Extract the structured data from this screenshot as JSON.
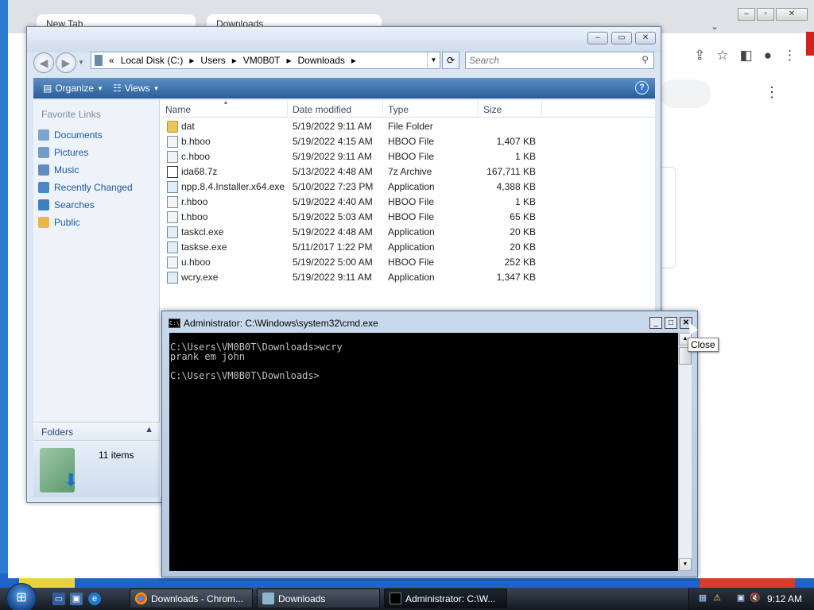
{
  "browser": {
    "tab1_label": "New Tab",
    "tab2_label": "Downloads"
  },
  "explorer": {
    "path": [
      "Local Disk (C:)",
      "Users",
      "VM0B0T",
      "Downloads"
    ],
    "search_placeholder": "Search",
    "toolbar": {
      "organize_label": "Organize",
      "views_label": "Views"
    },
    "favorite_links_header": "Favorite Links",
    "favorite_links": [
      {
        "label": "Documents",
        "icon": "documents-icon"
      },
      {
        "label": "Pictures",
        "icon": "pictures-icon"
      },
      {
        "label": "Music",
        "icon": "music-icon"
      },
      {
        "label": "Recently Changed",
        "icon": "recently-changed-icon"
      },
      {
        "label": "Searches",
        "icon": "searches-icon"
      },
      {
        "label": "Public",
        "icon": "public-folder-icon"
      }
    ],
    "folders_label": "Folders",
    "item_count": "11 items",
    "columns": [
      "Name",
      "Date modified",
      "Type",
      "Size"
    ],
    "files": [
      {
        "name": "dat",
        "date": "5/19/2022 9:11 AM",
        "type": "File Folder",
        "size": "",
        "icon": "folder"
      },
      {
        "name": "b.hboo",
        "date": "5/19/2022 4:15 AM",
        "type": "HBOO File",
        "size": "1,407 KB",
        "icon": "file"
      },
      {
        "name": "c.hboo",
        "date": "5/19/2022 9:11 AM",
        "type": "HBOO File",
        "size": "1 KB",
        "icon": "file"
      },
      {
        "name": "ida68.7z",
        "date": "5/13/2022 4:48 AM",
        "type": "7z Archive",
        "size": "167,711 KB",
        "icon": "archive"
      },
      {
        "name": "npp.8.4.Installer.x64.exe",
        "date": "5/10/2022 7:23 PM",
        "type": "Application",
        "size": "4,388 KB",
        "icon": "app"
      },
      {
        "name": "r.hboo",
        "date": "5/19/2022 4:40 AM",
        "type": "HBOO File",
        "size": "1 KB",
        "icon": "file"
      },
      {
        "name": "t.hboo",
        "date": "5/19/2022 5:03 AM",
        "type": "HBOO File",
        "size": "65 KB",
        "icon": "file"
      },
      {
        "name": "taskcl.exe",
        "date": "5/19/2022 4:48 AM",
        "type": "Application",
        "size": "20 KB",
        "icon": "app"
      },
      {
        "name": "taskse.exe",
        "date": "5/11/2017 1:22 PM",
        "type": "Application",
        "size": "20 KB",
        "icon": "app"
      },
      {
        "name": "u.hboo",
        "date": "5/19/2022 5:00 AM",
        "type": "HBOO File",
        "size": "252 KB",
        "icon": "file"
      },
      {
        "name": "wcry.exe",
        "date": "5/19/2022 9:11 AM",
        "type": "Application",
        "size": "1,347 KB",
        "icon": "app"
      }
    ]
  },
  "cmd": {
    "title": "Administrator: C:\\Windows\\system32\\cmd.exe",
    "lines": [
      "C:\\Users\\VM0B0T\\Downloads>wcry",
      "prank em john",
      "",
      "C:\\Users\\VM0B0T\\Downloads>"
    ],
    "close_tooltip": "Close"
  },
  "taskbar": {
    "tasks": [
      {
        "label": "Downloads - Chrom...",
        "icon": "chrome-icon",
        "active": false
      },
      {
        "label": "Downloads",
        "icon": "explorer-icon",
        "active": false
      },
      {
        "label": "Administrator: C:\\W...",
        "icon": "cmd-icon",
        "active": true
      }
    ],
    "clock": "9:12 AM"
  },
  "colors": {
    "command_bar": "#2a5d98",
    "link_text": "#1d57a2",
    "console_bg": "#000000",
    "console_text": "#c0c0c0"
  }
}
